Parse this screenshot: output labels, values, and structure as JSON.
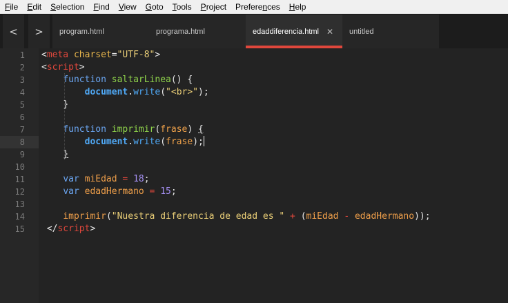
{
  "menu": [
    {
      "label": "File",
      "mnemonic": "F",
      "rest": "ile"
    },
    {
      "label": "Edit",
      "mnemonic": "E",
      "rest": "dit"
    },
    {
      "label": "Selection",
      "mnemonic": "S",
      "rest": "election"
    },
    {
      "label": "Find",
      "mnemonic": "F",
      "rest": "ind",
      "pre": ""
    },
    {
      "label": "View",
      "mnemonic": "V",
      "rest": "iew"
    },
    {
      "label": "Goto",
      "mnemonic": "G",
      "rest": "oto"
    },
    {
      "label": "Tools",
      "mnemonic": "T",
      "rest": "ools"
    },
    {
      "label": "Project",
      "mnemonic": "P",
      "rest": "roject"
    },
    {
      "label": "Preferences",
      "mnemonic": "n",
      "pre": "Prefere",
      "rest": "ces"
    },
    {
      "label": "Help",
      "mnemonic": "H",
      "rest": "elp"
    }
  ],
  "nav": {
    "back_icon": "chevron-left-icon",
    "back_glyph": "<",
    "forward_icon": "chevron-right-icon",
    "forward_glyph": ">"
  },
  "tabs": [
    {
      "label": "program.html",
      "active": false
    },
    {
      "label": "programa.html",
      "active": false
    },
    {
      "label": "edaddiferencia.html",
      "active": true,
      "close_glyph": "✕"
    },
    {
      "label": "untitled",
      "active": false
    }
  ],
  "editor": {
    "current_line": 8,
    "lines": [
      {
        "n": "1",
        "tokens": [
          [
            "t-punc",
            "<"
          ],
          [
            "t-tag",
            "meta"
          ],
          [
            "t-txt",
            " "
          ],
          [
            "t-attr",
            "charset"
          ],
          [
            "t-punc",
            "="
          ],
          [
            "t-str",
            "\"UTF-8\""
          ],
          [
            "t-punc",
            ">"
          ]
        ]
      },
      {
        "n": "2",
        "tokens": [
          [
            "t-punc",
            "<"
          ],
          [
            "t-tag",
            "script"
          ],
          [
            "t-punc",
            ">"
          ]
        ]
      },
      {
        "n": "3",
        "tokens": [
          [
            "t-txt",
            "    "
          ],
          [
            "t-kw",
            "function"
          ],
          [
            "t-txt",
            " "
          ],
          [
            "t-fn",
            "saltarLinea"
          ],
          [
            "t-punc",
            "() {"
          ]
        ]
      },
      {
        "n": "4",
        "tokens": [
          [
            "t-txt",
            "        "
          ],
          [
            "t-obj",
            "document"
          ],
          [
            "t-punc",
            "."
          ],
          [
            "t-meth",
            "write"
          ],
          [
            "t-punc",
            "("
          ],
          [
            "t-str",
            "\"<br>\""
          ],
          [
            "t-punc",
            ");"
          ]
        ]
      },
      {
        "n": "5",
        "tokens": [
          [
            "t-txt",
            "    "
          ],
          [
            "t-punc",
            "}"
          ]
        ]
      },
      {
        "n": "6",
        "tokens": []
      },
      {
        "n": "7",
        "tokens": [
          [
            "t-txt",
            "    "
          ],
          [
            "t-kw",
            "function"
          ],
          [
            "t-txt",
            " "
          ],
          [
            "t-fn",
            "imprimir"
          ],
          [
            "t-punc",
            "("
          ],
          [
            "t-param",
            "frase"
          ],
          [
            "t-punc",
            ") "
          ],
          [
            "t-punc u",
            "{"
          ]
        ]
      },
      {
        "n": "8",
        "tokens": [
          [
            "t-txt",
            "        "
          ],
          [
            "t-obj",
            "document"
          ],
          [
            "t-punc",
            "."
          ],
          [
            "t-meth",
            "write"
          ],
          [
            "t-punc",
            "("
          ],
          [
            "t-param",
            "frase"
          ],
          [
            "t-punc",
            ");"
          ]
        ],
        "caret": true
      },
      {
        "n": "9",
        "tokens": [
          [
            "t-txt",
            "    "
          ],
          [
            "t-punc u",
            "}"
          ]
        ]
      },
      {
        "n": "10",
        "tokens": []
      },
      {
        "n": "11",
        "tokens": [
          [
            "t-txt",
            "    "
          ],
          [
            "t-kw",
            "var"
          ],
          [
            "t-txt",
            " "
          ],
          [
            "t-var",
            "miEdad"
          ],
          [
            "t-txt",
            " "
          ],
          [
            "t-op",
            "="
          ],
          [
            "t-txt",
            " "
          ],
          [
            "t-num",
            "18"
          ],
          [
            "t-punc",
            ";"
          ]
        ]
      },
      {
        "n": "12",
        "tokens": [
          [
            "t-txt",
            "    "
          ],
          [
            "t-kw",
            "var"
          ],
          [
            "t-txt",
            " "
          ],
          [
            "t-var",
            "edadHermano"
          ],
          [
            "t-txt",
            " "
          ],
          [
            "t-op",
            "="
          ],
          [
            "t-txt",
            " "
          ],
          [
            "t-num",
            "15"
          ],
          [
            "t-punc",
            ";"
          ]
        ]
      },
      {
        "n": "13",
        "tokens": []
      },
      {
        "n": "14",
        "tokens": [
          [
            "t-txt",
            "    "
          ],
          [
            "t-var",
            "imprimir"
          ],
          [
            "t-punc",
            "("
          ],
          [
            "t-str",
            "\"Nuestra diferencia de edad es \""
          ],
          [
            "t-txt",
            " "
          ],
          [
            "t-op",
            "+"
          ],
          [
            "t-txt",
            " "
          ],
          [
            "t-punc",
            "("
          ],
          [
            "t-var",
            "miEdad"
          ],
          [
            "t-txt",
            " "
          ],
          [
            "t-op",
            "-"
          ],
          [
            "t-txt",
            " "
          ],
          [
            "t-var",
            "edadHermano"
          ],
          [
            "t-punc",
            "));"
          ]
        ]
      },
      {
        "n": "15",
        "tokens": [
          [
            "t-txt",
            " "
          ],
          [
            "t-punc",
            "</"
          ],
          [
            "t-tag",
            "script"
          ],
          [
            "t-punc",
            ">"
          ]
        ]
      }
    ]
  }
}
